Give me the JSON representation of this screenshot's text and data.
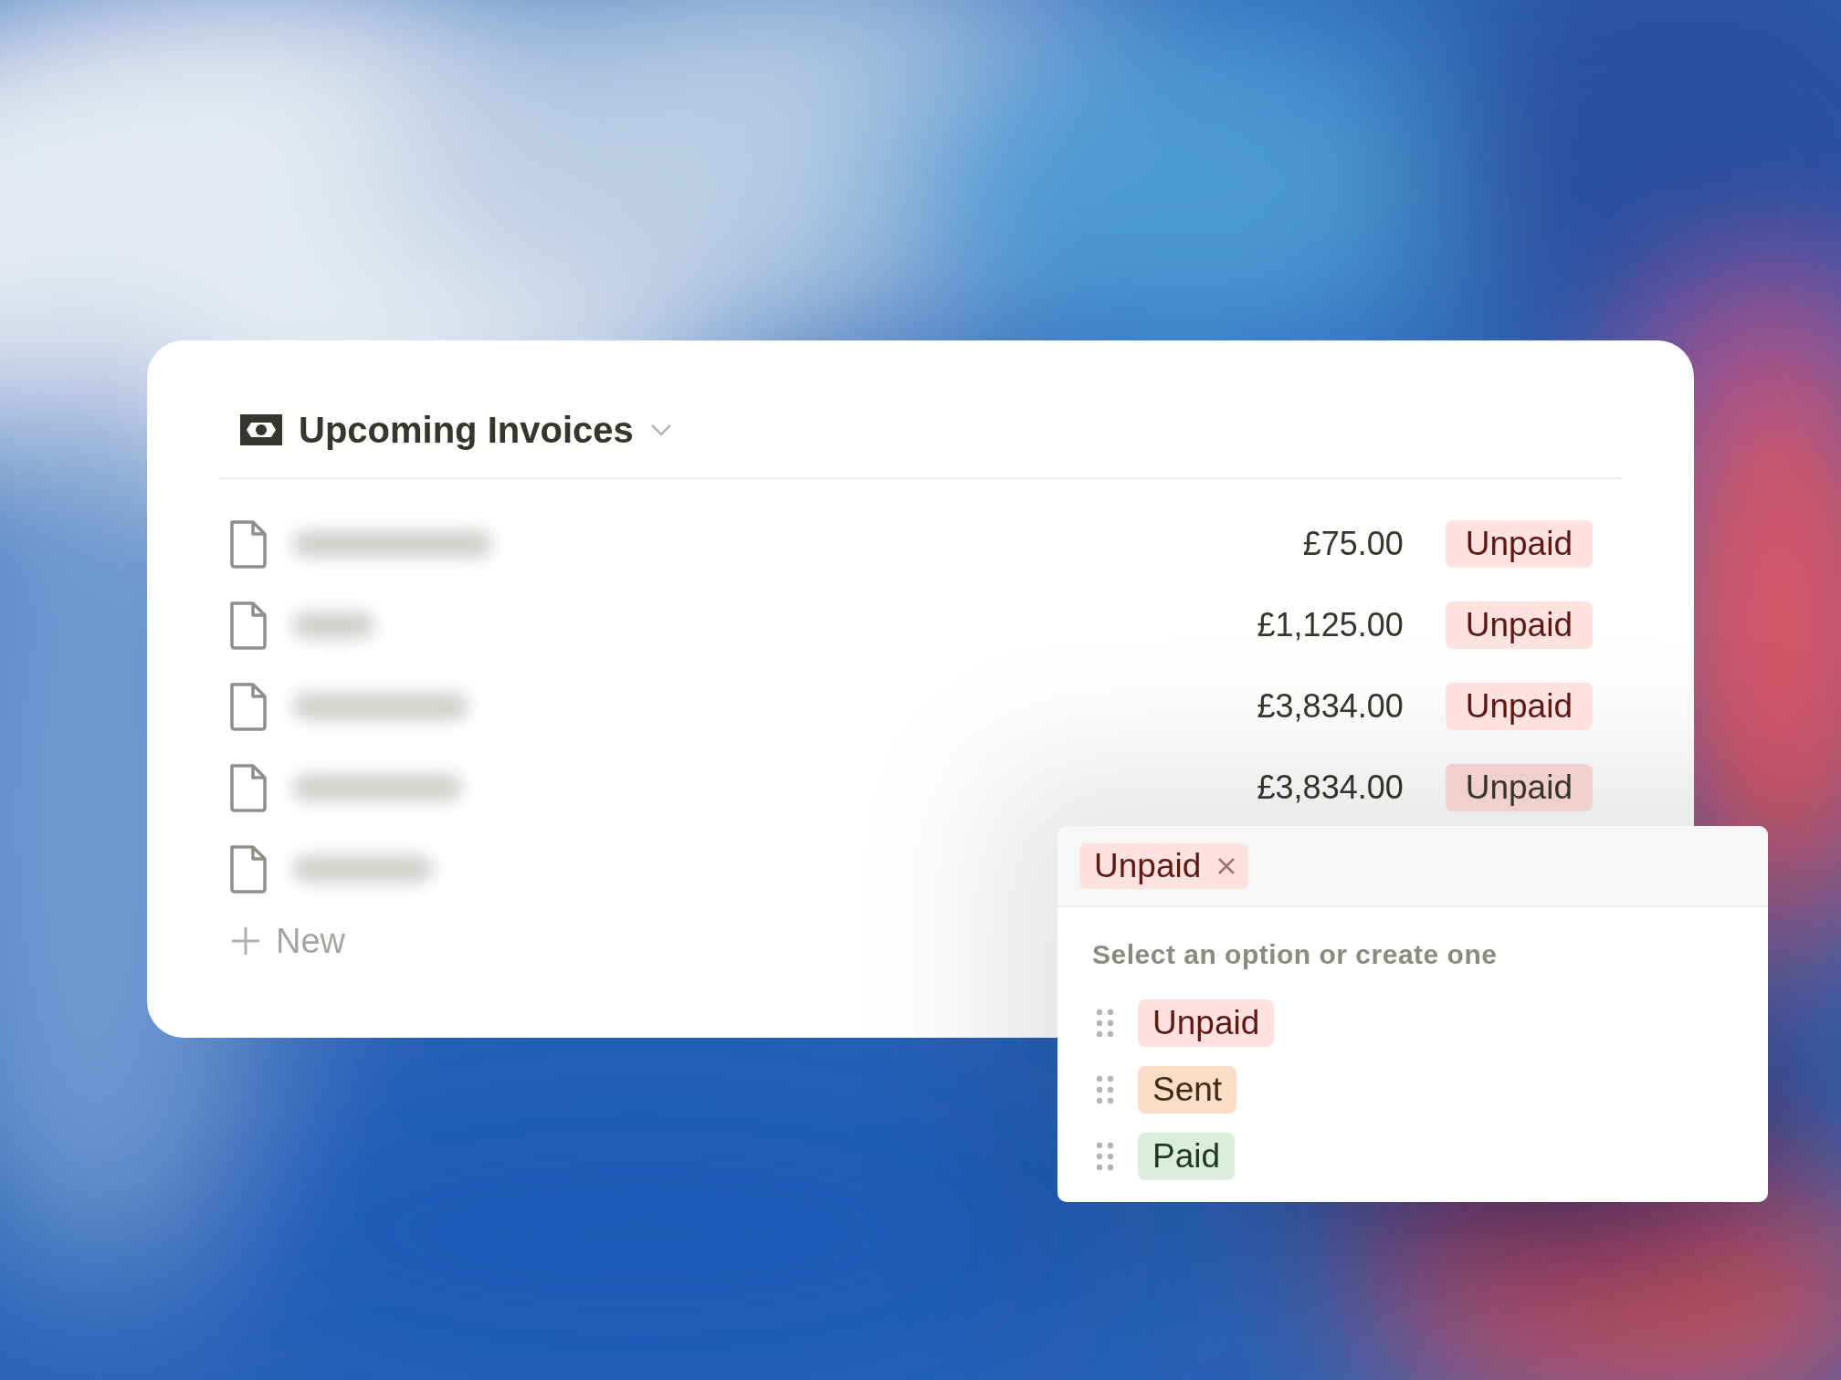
{
  "database": {
    "title": "Upcoming Invoices"
  },
  "rows": [
    {
      "amount": "£75.00",
      "status": {
        "label": "Unpaid",
        "color": "#ffe2dd"
      }
    },
    {
      "amount": "£1,125.00",
      "status": {
        "label": "Unpaid",
        "color": "#ffe2dd"
      }
    },
    {
      "amount": "£3,834.00",
      "status": {
        "label": "Unpaid",
        "color": "#ffe2dd"
      }
    },
    {
      "amount": "£3,834.00",
      "status": {
        "label": "Unpaid",
        "color": "#efd0cc"
      }
    },
    {}
  ],
  "new_button": "New",
  "dropdown": {
    "selected_tags": [
      {
        "label": "Unpaid",
        "color": "#ffe2dd"
      }
    ],
    "hint": "Select an option or create one",
    "options": [
      {
        "label": "Unpaid",
        "color": "#ffe2dd"
      },
      {
        "label": "Sent",
        "color": "#fadec9"
      },
      {
        "label": "Paid",
        "color": "#dbeddb"
      }
    ]
  }
}
